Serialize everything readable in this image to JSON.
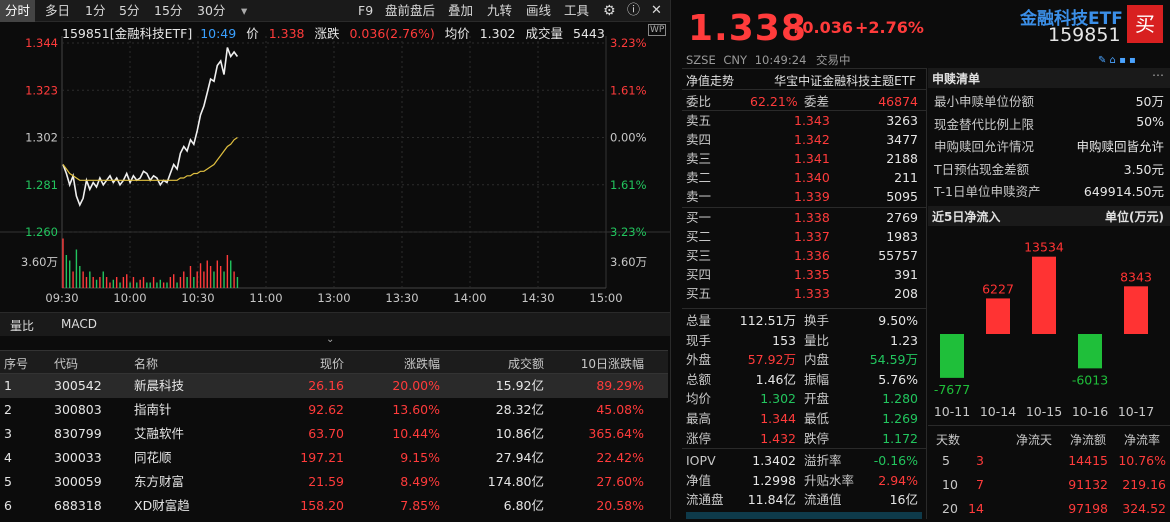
{
  "toolbar": {
    "tabs": [
      "分时",
      "多日",
      "1分",
      "5分",
      "15分",
      "30分"
    ],
    "right_items": [
      "F9",
      "盘前盘后",
      "叠加",
      "九转",
      "画线",
      "工具"
    ]
  },
  "chart_header": {
    "code_name": "159851[金融科技ETF]",
    "time": "10:49",
    "price_label": "价",
    "price": "1.338",
    "change_label": "涨跌",
    "change": "0.036(2.76%)",
    "avg_label": "均价",
    "avg": "1.302",
    "vol_label": "成交量",
    "vol": "5443"
  },
  "chart_data": {
    "type": "line",
    "y_ticks_left": [
      "1.344",
      "1.323",
      "1.302",
      "1.281",
      "1.260"
    ],
    "y_ticks_right": [
      "3.23%",
      "1.61%",
      "0.00%",
      "1.61%",
      "3.23%"
    ],
    "vol_tick": "3.60万",
    "x_ticks": [
      "09:30",
      "10:00",
      "10:30",
      "11:00",
      "13:00",
      "13:30",
      "14:00",
      "14:30",
      "15:00"
    ],
    "ylim": [
      1.26,
      1.344
    ],
    "series": [
      {
        "values": [
          1.29,
          1.286,
          1.281,
          1.285,
          1.276,
          1.272,
          1.275,
          1.283,
          1.279,
          1.282,
          1.28,
          1.284,
          1.281,
          1.283,
          1.285,
          1.282,
          1.284,
          1.281,
          1.283,
          1.286,
          1.282,
          1.285,
          1.283,
          1.284,
          1.287,
          1.286,
          1.283,
          1.285,
          1.284,
          1.281,
          1.283,
          1.282,
          1.286,
          1.29,
          1.288,
          1.295,
          1.298,
          1.296,
          1.301,
          1.299,
          1.305,
          1.312,
          1.316,
          1.322,
          1.328,
          1.327,
          1.334,
          1.336,
          1.33,
          1.342,
          1.338,
          1.34,
          1.338
        ]
      },
      {
        "values": [
          1.29,
          1.288,
          1.286,
          1.285,
          1.284,
          1.283,
          1.283,
          1.283,
          1.283,
          1.283,
          1.283,
          1.283,
          1.283,
          1.283,
          1.283,
          1.283,
          1.283,
          1.283,
          1.283,
          1.283,
          1.283,
          1.283,
          1.283,
          1.283,
          1.283,
          1.283,
          1.283,
          1.283,
          1.283,
          1.283,
          1.283,
          1.283,
          1.283,
          1.283,
          1.283,
          1.284,
          1.284,
          1.285,
          1.285,
          1.286,
          1.286,
          1.287,
          1.287,
          1.288,
          1.289,
          1.29,
          1.292,
          1.294,
          1.296,
          1.298,
          1.299,
          1.301,
          1.302
        ]
      }
    ],
    "volumes": [
      0.9,
      0.6,
      0.5,
      0.3,
      0.7,
      0.4,
      0.3,
      0.2,
      0.3,
      0.2,
      0.15,
      0.2,
      0.3,
      0.2,
      0.1,
      0.15,
      0.2,
      0.1,
      0.2,
      0.25,
      0.1,
      0.2,
      0.1,
      0.15,
      0.2,
      0.1,
      0.1,
      0.2,
      0.1,
      0.15,
      0.1,
      0.1,
      0.2,
      0.25,
      0.1,
      0.2,
      0.3,
      0.2,
      0.4,
      0.2,
      0.3,
      0.45,
      0.3,
      0.5,
      0.4,
      0.3,
      0.5,
      0.4,
      0.3,
      0.6,
      0.5,
      0.3,
      0.2
    ]
  },
  "sub_tabs": [
    "量比",
    "MACD"
  ],
  "table": {
    "headers": [
      "序号",
      "代码",
      "名称",
      "现价",
      "涨跌幅",
      "成交额",
      "10日涨跌幅"
    ],
    "rows": [
      [
        "1",
        "300542",
        "新晨科技",
        "26.16",
        "20.00%",
        "15.92亿",
        "89.29%"
      ],
      [
        "2",
        "300803",
        "指南针",
        "92.62",
        "13.60%",
        "28.32亿",
        "45.08%"
      ],
      [
        "3",
        "830799",
        "艾融软件",
        "63.70",
        "10.44%",
        "10.86亿",
        "365.64%"
      ],
      [
        "4",
        "300033",
        "同花顺",
        "197.21",
        "9.15%",
        "27.94亿",
        "22.42%"
      ],
      [
        "5",
        "300059",
        "东方财富",
        "21.59",
        "8.49%",
        "174.80亿",
        "27.60%"
      ],
      [
        "6",
        "688318",
        "XD财富趋",
        "158.20",
        "7.85%",
        "6.80亿",
        "20.58%"
      ]
    ]
  },
  "quote": {
    "price": "1.338",
    "change": "+0.036",
    "pct": "+2.76%",
    "name": "金融科技ETF",
    "code": "159851",
    "buy_label": "买",
    "exchange": "SZSE",
    "currency": "CNY",
    "time": "10:49:24",
    "status": "交易中"
  },
  "nav_line": {
    "label": "净值走势",
    "index": "华宝中证金融科技主题ETF"
  },
  "weibi": {
    "label1": "委比",
    "val1": "62.21%",
    "label2": "委差",
    "val2": "46874"
  },
  "asks": [
    {
      "label": "卖五",
      "price": "1.343",
      "vol": "3263"
    },
    {
      "label": "卖四",
      "price": "1.342",
      "vol": "3477"
    },
    {
      "label": "卖三",
      "price": "1.341",
      "vol": "2188"
    },
    {
      "label": "卖二",
      "price": "1.340",
      "vol": "211"
    },
    {
      "label": "卖一",
      "price": "1.339",
      "vol": "5095"
    }
  ],
  "bids": [
    {
      "label": "买一",
      "price": "1.338",
      "vol": "2769"
    },
    {
      "label": "买二",
      "price": "1.337",
      "vol": "1983"
    },
    {
      "label": "买三",
      "price": "1.336",
      "vol": "55757"
    },
    {
      "label": "买四",
      "price": "1.335",
      "vol": "391"
    },
    {
      "label": "买五",
      "price": "1.333",
      "vol": "208"
    }
  ],
  "stats": [
    {
      "l1": "总量",
      "v1": "112.51万",
      "l2": "换手",
      "v2": "9.50%",
      "c1": "white",
      "c2": "white"
    },
    {
      "l1": "现手",
      "v1": "153",
      "l2": "量比",
      "v2": "1.23",
      "c1": "white",
      "c2": "white"
    },
    {
      "l1": "外盘",
      "v1": "57.92万",
      "l2": "内盘",
      "v2": "54.59万",
      "c1": "red",
      "c2": "green"
    },
    {
      "l1": "总额",
      "v1": "1.46亿",
      "l2": "振幅",
      "v2": "5.76%",
      "c1": "white",
      "c2": "white"
    },
    {
      "l1": "均价",
      "v1": "1.302",
      "l2": "开盘",
      "v2": "1.280",
      "c1": "green",
      "c2": "green"
    },
    {
      "l1": "最高",
      "v1": "1.344",
      "l2": "最低",
      "v2": "1.269",
      "c1": "red",
      "c2": "green"
    },
    {
      "l1": "涨停",
      "v1": "1.432",
      "l2": "跌停",
      "v2": "1.172",
      "c1": "red",
      "c2": "green"
    }
  ],
  "iopv": [
    {
      "l1": "IOPV",
      "v1": "1.3402",
      "l2": "溢折率",
      "v2": "-0.16%",
      "c1": "white",
      "c2": "green"
    },
    {
      "l1": "净值",
      "v1": "1.2998",
      "l2": "升贴水率",
      "v2": "2.94%",
      "c1": "white",
      "c2": "red"
    },
    {
      "l1": "流通盘",
      "v1": "11.84亿",
      "l2": "流通值",
      "v2": "16亿",
      "c1": "white",
      "c2": "white"
    }
  ],
  "subscribe": {
    "title": "申赎清单",
    "rows": [
      {
        "label": "最小申赎单位份额",
        "value": "50万"
      },
      {
        "label": "现金替代比例上限",
        "value": "50%"
      },
      {
        "label": "申购赎回允许情况",
        "value": "申购赎回皆允许"
      },
      {
        "label": "T日预估现金差额",
        "value": "3.50元"
      },
      {
        "label": "T-1日单位申赎资产",
        "value": "649914.50元"
      }
    ]
  },
  "netflow": {
    "title": "近5日净流入",
    "unit": "单位(万元)",
    "dates": [
      "10-11",
      "10-14",
      "10-15",
      "10-16",
      "10-17"
    ],
    "values": [
      -7677,
      6227,
      13534,
      -6013,
      8343
    ],
    "colors": {
      "pos": "#ff3333",
      "neg": "#1fbf3a"
    }
  },
  "flow_table": {
    "headers": [
      "天数",
      "净流天",
      "净流额",
      "净流率"
    ],
    "rows": [
      [
        "5",
        "3",
        "14415",
        "10.76%"
      ],
      [
        "10",
        "7",
        "91132",
        "219.16"
      ],
      [
        "20",
        "14",
        "97198",
        "324.52"
      ]
    ]
  },
  "colors": {
    "red": "#ff3b3b",
    "green": "#22c55e",
    "yellow": "#e0c040",
    "white_line": "#f0f0f0"
  }
}
